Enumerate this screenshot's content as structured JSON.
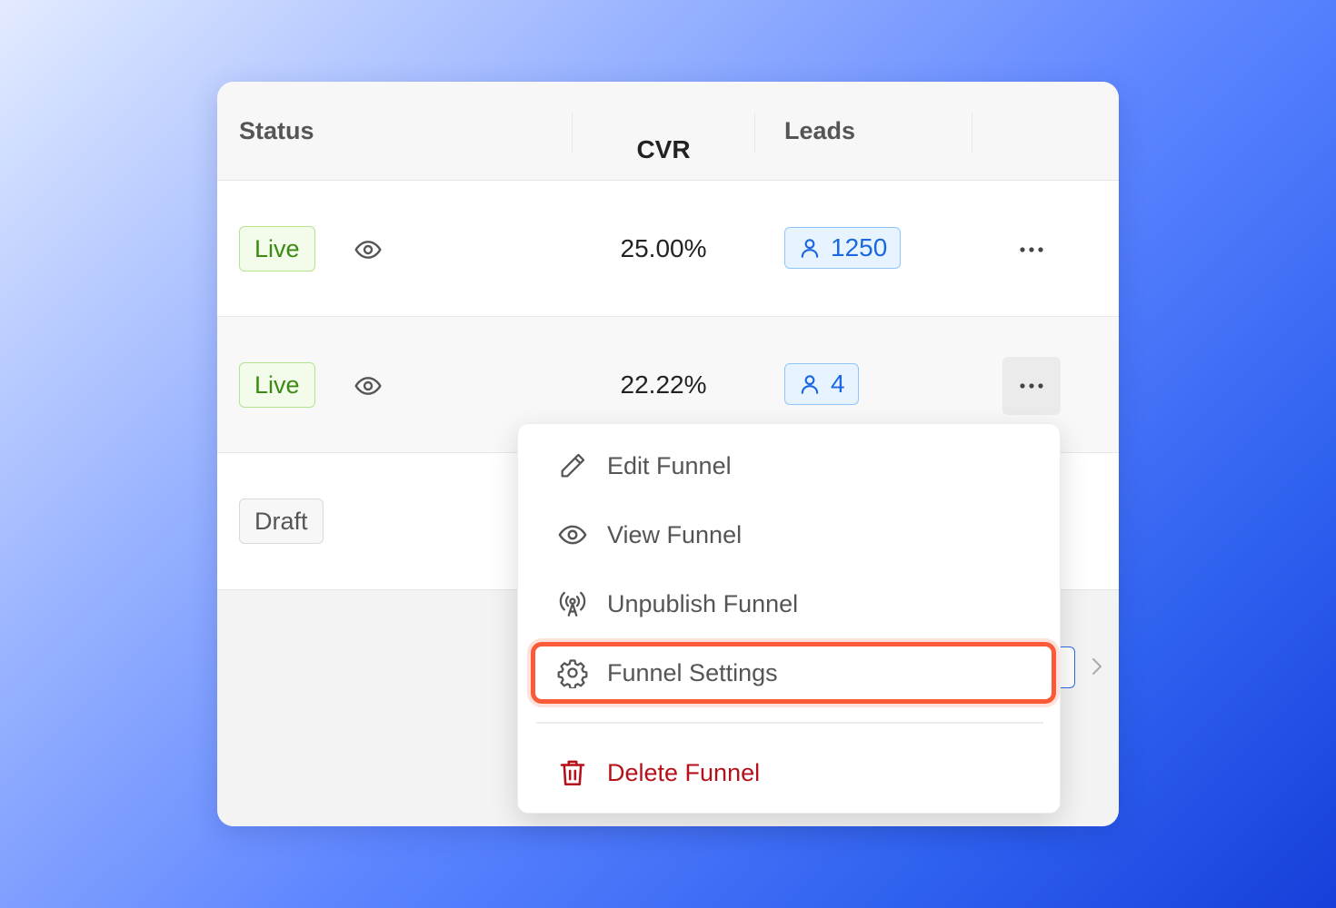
{
  "table": {
    "headers": {
      "status": "Status",
      "cvr": "CVR",
      "leads": "Leads"
    },
    "rows": [
      {
        "status": "Live",
        "cvr": "25.00%",
        "leads": "1250"
      },
      {
        "status": "Live",
        "cvr": "22.22%",
        "leads": "4"
      },
      {
        "status": "Draft"
      }
    ]
  },
  "menu": {
    "items": [
      {
        "label": "Edit Funnel",
        "icon": "pencil-icon"
      },
      {
        "label": "View Funnel",
        "icon": "eye-icon"
      },
      {
        "label": "Unpublish Funnel",
        "icon": "broadcast-icon"
      },
      {
        "label": "Funnel Settings",
        "icon": "gear-icon"
      },
      {
        "label": "Delete Funnel",
        "icon": "trash-icon"
      }
    ]
  },
  "colors": {
    "live_text": "#3b8a12",
    "leads_text": "#1b67e0",
    "danger": "#b5111b",
    "highlight": "#fa5a37"
  }
}
